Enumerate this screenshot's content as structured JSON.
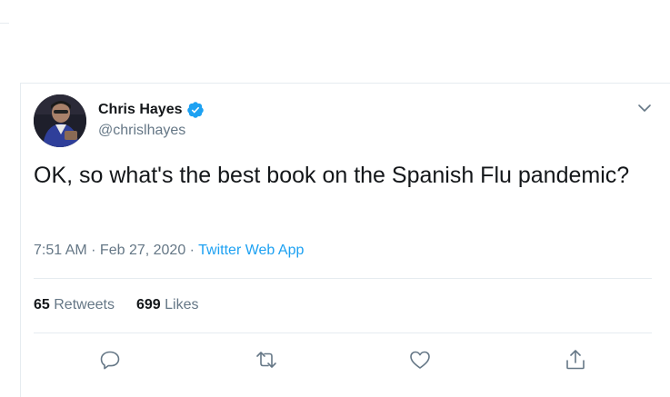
{
  "tweet": {
    "display_name": "Chris Hayes",
    "handle": "@chrislhayes",
    "text": "OK, so what's the best book on the Spanish Flu pandemic?",
    "time": "7:51 AM",
    "date": "Feb 27, 2020",
    "separator": " · ",
    "source": "Twitter Web App",
    "retweets_count": "65",
    "retweets_label": "Retweets",
    "likes_count": "699",
    "likes_label": "Likes"
  },
  "icons": {
    "verified": "verified-badge-icon",
    "more": "chevron-down-icon",
    "reply": "reply-icon",
    "retweet": "retweet-icon",
    "like": "heart-icon",
    "share": "share-icon"
  },
  "colors": {
    "accent": "#1da1f2",
    "secondary_text": "#657786",
    "primary_text": "#14171a",
    "divider": "#e6ecf0"
  }
}
